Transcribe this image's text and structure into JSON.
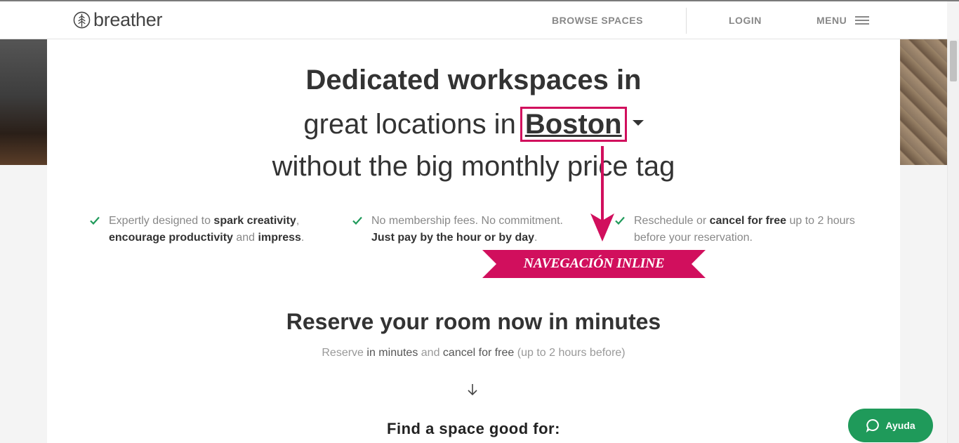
{
  "nav": {
    "logo_text": "breather",
    "browse_label": "BROWSE SPACES",
    "login_label": "LOGIN",
    "menu_label": "MENU"
  },
  "hero": {
    "line1": "Dedicated workspaces in",
    "line2_prefix": "great locations in",
    "city": "Boston",
    "line3": "without the big monthly price tag"
  },
  "features": [
    {
      "parts": [
        {
          "t": "Expertly designed to ",
          "b": false
        },
        {
          "t": "spark creativity",
          "b": true
        },
        {
          "t": ", ",
          "b": false
        },
        {
          "t": "encourage productivity",
          "b": true
        },
        {
          "t": " and ",
          "b": false
        },
        {
          "t": "impress",
          "b": true
        },
        {
          "t": ".",
          "b": false
        }
      ]
    },
    {
      "parts": [
        {
          "t": "No membership fees. No commitment. ",
          "b": false
        },
        {
          "t": "Just pay by the hour or by day",
          "b": true
        },
        {
          "t": ".",
          "b": false
        }
      ]
    },
    {
      "parts": [
        {
          "t": "Reschedule or ",
          "b": false
        },
        {
          "t": "cancel for free",
          "b": true
        },
        {
          "t": " up to 2 hours before your reservation.",
          "b": false
        }
      ]
    }
  ],
  "annotation": {
    "label": "NAVEGACIÓN INLINE",
    "color": "#d10f5d"
  },
  "reserve": {
    "title": "Reserve your room now in minutes",
    "sub_1": "Reserve ",
    "sub_2": "in minutes",
    "sub_3": " and ",
    "sub_4": "cancel for free",
    "sub_5": " (up to 2 hours before)"
  },
  "find": {
    "title": "Find a space good for:"
  },
  "help": {
    "label": "Ayuda",
    "color": "#1f9a5a"
  },
  "colors": {
    "check": "#1f9a5a",
    "accent": "#d10f5d"
  }
}
